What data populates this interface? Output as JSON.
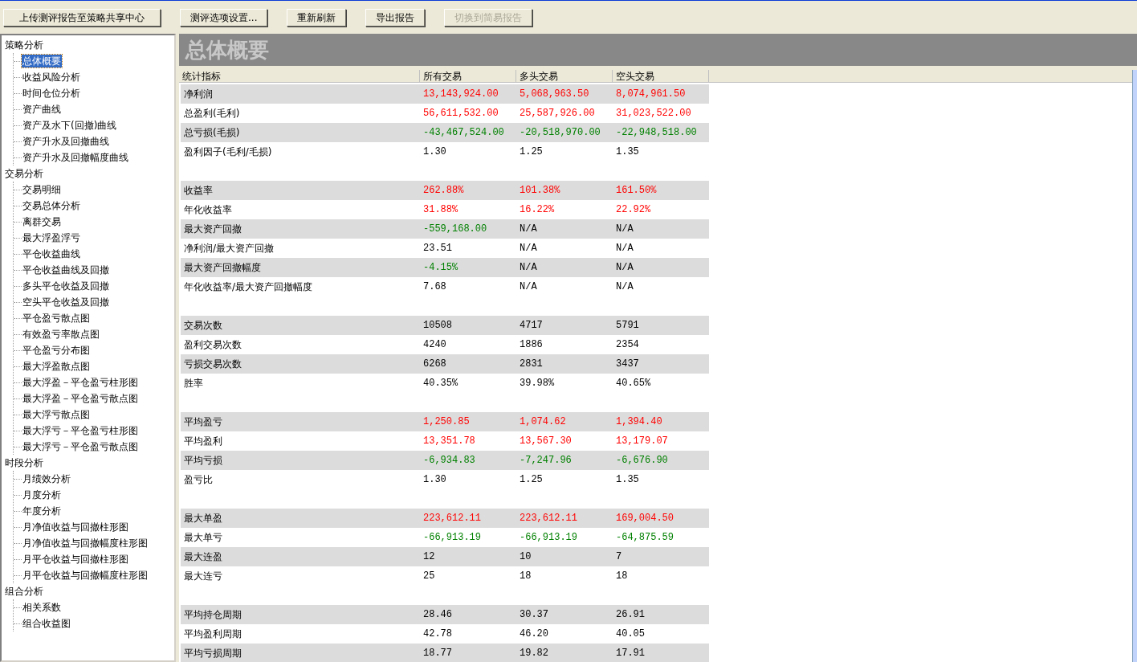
{
  "toolbar": [
    {
      "label": "上传测评报告至策略共享中心",
      "disabled": false
    },
    {
      "label": "测评选项设置...",
      "disabled": false
    },
    {
      "label": "重新刷新",
      "disabled": false
    },
    {
      "label": "导出报告",
      "disabled": false
    },
    {
      "label": "切换到简易报告",
      "disabled": true
    }
  ],
  "tree": [
    {
      "label": "策略分析",
      "children": [
        {
          "label": "总体概要",
          "selected": true
        },
        {
          "label": "收益风险分析",
          "selected": false
        },
        {
          "label": "时间仓位分析",
          "selected": false
        },
        {
          "label": "资产曲线",
          "selected": false
        },
        {
          "label": "资产及水下(回撤)曲线",
          "selected": false
        },
        {
          "label": "资产升水及回撤曲线",
          "selected": false
        },
        {
          "label": "资产升水及回撤幅度曲线",
          "selected": false
        }
      ]
    },
    {
      "label": "交易分析",
      "children": [
        {
          "label": "交易明细",
          "selected": false
        },
        {
          "label": "交易总体分析",
          "selected": false
        },
        {
          "label": "离群交易",
          "selected": false
        },
        {
          "label": "最大浮盈浮亏",
          "selected": false
        },
        {
          "label": "平仓收益曲线",
          "selected": false
        },
        {
          "label": "平仓收益曲线及回撤",
          "selected": false
        },
        {
          "label": "多头平仓收益及回撤",
          "selected": false
        },
        {
          "label": "空头平仓收益及回撤",
          "selected": false
        },
        {
          "label": "平仓盈亏散点图",
          "selected": false
        },
        {
          "label": "有效盈亏率散点图",
          "selected": false
        },
        {
          "label": "平仓盈亏分布图",
          "selected": false
        },
        {
          "label": "最大浮盈散点图",
          "selected": false
        },
        {
          "label": "最大浮盈－平仓盈亏柱形图",
          "selected": false
        },
        {
          "label": "最大浮盈－平仓盈亏散点图",
          "selected": false
        },
        {
          "label": "最大浮亏散点图",
          "selected": false
        },
        {
          "label": "最大浮亏－平仓盈亏柱形图",
          "selected": false
        },
        {
          "label": "最大浮亏－平仓盈亏散点图",
          "selected": false
        }
      ]
    },
    {
      "label": "时段分析",
      "children": [
        {
          "label": "月绩效分析",
          "selected": false
        },
        {
          "label": "月度分析",
          "selected": false
        },
        {
          "label": "年度分析",
          "selected": false
        },
        {
          "label": "月净值收益与回撤柱形图",
          "selected": false
        },
        {
          "label": "月净值收益与回撤幅度柱形图",
          "selected": false
        },
        {
          "label": "月平仓收益与回撤柱形图",
          "selected": false
        },
        {
          "label": "月平仓收益与回撤幅度柱形图",
          "selected": false
        }
      ]
    },
    {
      "label": "组合分析",
      "children": [
        {
          "label": "相关系数",
          "selected": false
        },
        {
          "label": "组合收益图",
          "selected": false
        }
      ]
    }
  ],
  "panel_title": "总体概要",
  "table": {
    "columns": [
      "统计指标",
      "所有交易",
      "多头交易",
      "空头交易"
    ],
    "groups": [
      {
        "rows": [
          {
            "label": "净利润",
            "cells": [
              {
                "text": "13,143,924.00",
                "kind": "gain"
              },
              {
                "text": "5,068,963.50",
                "kind": "gain"
              },
              {
                "text": "8,074,961.50",
                "kind": "gain"
              }
            ]
          },
          {
            "label": "总盈利(毛利)",
            "cells": [
              {
                "text": "56,611,532.00",
                "kind": "gain"
              },
              {
                "text": "25,587,926.00",
                "kind": "gain"
              },
              {
                "text": "31,023,522.00",
                "kind": "gain"
              }
            ]
          },
          {
            "label": "总亏损(毛损)",
            "cells": [
              {
                "text": "-43,467,524.00",
                "kind": "loss"
              },
              {
                "text": "-20,518,970.00",
                "kind": "loss"
              },
              {
                "text": "-22,948,518.00",
                "kind": "loss"
              }
            ]
          },
          {
            "label": "盈利因子(毛利/毛损)",
            "cells": [
              {
                "text": "1.30",
                "kind": "plain"
              },
              {
                "text": "1.25",
                "kind": "plain"
              },
              {
                "text": "1.35",
                "kind": "plain"
              }
            ]
          }
        ]
      },
      {
        "rows": [
          {
            "label": "收益率",
            "cells": [
              {
                "text": "262.88%",
                "kind": "gain"
              },
              {
                "text": "101.38%",
                "kind": "gain"
              },
              {
                "text": "161.50%",
                "kind": "gain"
              }
            ]
          },
          {
            "label": "年化收益率",
            "cells": [
              {
                "text": "31.88%",
                "kind": "gain"
              },
              {
                "text": "16.22%",
                "kind": "gain"
              },
              {
                "text": "22.92%",
                "kind": "gain"
              }
            ]
          },
          {
            "label": "最大资产回撤",
            "cells": [
              {
                "text": "-559,168.00",
                "kind": "loss"
              },
              {
                "text": "N/A",
                "kind": "plain"
              },
              {
                "text": "N/A",
                "kind": "plain"
              }
            ]
          },
          {
            "label": "净利润/最大资产回撤",
            "cells": [
              {
                "text": "23.51",
                "kind": "plain"
              },
              {
                "text": "N/A",
                "kind": "plain"
              },
              {
                "text": "N/A",
                "kind": "plain"
              }
            ]
          },
          {
            "label": "最大资产回撤幅度",
            "cells": [
              {
                "text": "-4.15%",
                "kind": "loss"
              },
              {
                "text": "N/A",
                "kind": "plain"
              },
              {
                "text": "N/A",
                "kind": "plain"
              }
            ]
          },
          {
            "label": "年化收益率/最大资产回撤幅度",
            "cells": [
              {
                "text": "7.68",
                "kind": "plain"
              },
              {
                "text": "N/A",
                "kind": "plain"
              },
              {
                "text": "N/A",
                "kind": "plain"
              }
            ]
          }
        ]
      },
      {
        "rows": [
          {
            "label": "交易次数",
            "cells": [
              {
                "text": "10508",
                "kind": "plain"
              },
              {
                "text": "4717",
                "kind": "plain"
              },
              {
                "text": "5791",
                "kind": "plain"
              }
            ]
          },
          {
            "label": "盈利交易次数",
            "cells": [
              {
                "text": "4240",
                "kind": "plain"
              },
              {
                "text": "1886",
                "kind": "plain"
              },
              {
                "text": "2354",
                "kind": "plain"
              }
            ]
          },
          {
            "label": "亏损交易次数",
            "cells": [
              {
                "text": "6268",
                "kind": "plain"
              },
              {
                "text": "2831",
                "kind": "plain"
              },
              {
                "text": "3437",
                "kind": "plain"
              }
            ]
          },
          {
            "label": "胜率",
            "cells": [
              {
                "text": "40.35%",
                "kind": "plain"
              },
              {
                "text": "39.98%",
                "kind": "plain"
              },
              {
                "text": "40.65%",
                "kind": "plain"
              }
            ]
          }
        ]
      },
      {
        "rows": [
          {
            "label": "平均盈亏",
            "cells": [
              {
                "text": "1,250.85",
                "kind": "gain"
              },
              {
                "text": "1,074.62",
                "kind": "gain"
              },
              {
                "text": "1,394.40",
                "kind": "gain"
              }
            ]
          },
          {
            "label": "平均盈利",
            "cells": [
              {
                "text": "13,351.78",
                "kind": "gain"
              },
              {
                "text": "13,567.30",
                "kind": "gain"
              },
              {
                "text": "13,179.07",
                "kind": "gain"
              }
            ]
          },
          {
            "label": "平均亏损",
            "cells": [
              {
                "text": "-6,934.83",
                "kind": "loss"
              },
              {
                "text": "-7,247.96",
                "kind": "loss"
              },
              {
                "text": "-6,676.90",
                "kind": "loss"
              }
            ]
          },
          {
            "label": "盈亏比",
            "cells": [
              {
                "text": "1.30",
                "kind": "plain"
              },
              {
                "text": "1.25",
                "kind": "plain"
              },
              {
                "text": "1.35",
                "kind": "plain"
              }
            ]
          }
        ]
      },
      {
        "rows": [
          {
            "label": "最大单盈",
            "cells": [
              {
                "text": "223,612.11",
                "kind": "gain"
              },
              {
                "text": "223,612.11",
                "kind": "gain"
              },
              {
                "text": "169,004.50",
                "kind": "gain"
              }
            ]
          },
          {
            "label": "最大单亏",
            "cells": [
              {
                "text": "-66,913.19",
                "kind": "loss"
              },
              {
                "text": "-66,913.19",
                "kind": "loss"
              },
              {
                "text": "-64,875.59",
                "kind": "loss"
              }
            ]
          },
          {
            "label": "最大连盈",
            "cells": [
              {
                "text": "12",
                "kind": "plain"
              },
              {
                "text": "10",
                "kind": "plain"
              },
              {
                "text": "7",
                "kind": "plain"
              }
            ]
          },
          {
            "label": "最大连亏",
            "cells": [
              {
                "text": "25",
                "kind": "plain"
              },
              {
                "text": "18",
                "kind": "plain"
              },
              {
                "text": "18",
                "kind": "plain"
              }
            ]
          }
        ]
      },
      {
        "rows": [
          {
            "label": "平均持仓周期",
            "cells": [
              {
                "text": "28.46",
                "kind": "plain"
              },
              {
                "text": "30.37",
                "kind": "plain"
              },
              {
                "text": "26.91",
                "kind": "plain"
              }
            ]
          },
          {
            "label": "平均盈利周期",
            "cells": [
              {
                "text": "42.78",
                "kind": "plain"
              },
              {
                "text": "46.20",
                "kind": "plain"
              },
              {
                "text": "40.05",
                "kind": "plain"
              }
            ]
          },
          {
            "label": "平均亏损周期",
            "cells": [
              {
                "text": "18.77",
                "kind": "plain"
              },
              {
                "text": "19.82",
                "kind": "plain"
              },
              {
                "text": "17.91",
                "kind": "plain"
              }
            ]
          }
        ]
      }
    ]
  }
}
